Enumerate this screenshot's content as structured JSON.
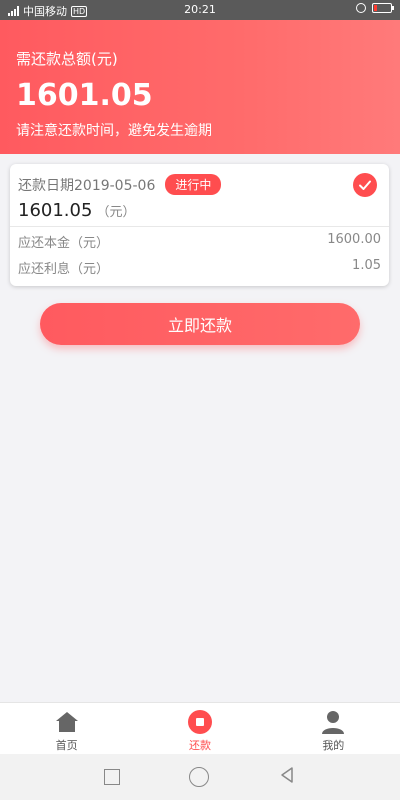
{
  "status_bar": {
    "carrier": "中国移动",
    "network": "HD",
    "time": "20:21"
  },
  "header": {
    "label": "需还款总额(元)",
    "amount": "1601.05",
    "tip": "请注意还款时间，避免发生逾期"
  },
  "card": {
    "date_label": "还款日期2019-05-06",
    "status": "进行中",
    "amount": "1601.05",
    "unit": "（元）",
    "principal_label": "应还本金（元）",
    "principal_value": "1600.00",
    "interest_label": "应还利息（元）",
    "interest_value": "1.05"
  },
  "repay_button": {
    "label": "立即还款"
  },
  "tabs": [
    {
      "label": "首页",
      "icon": "home-icon",
      "active": false
    },
    {
      "label": "还款",
      "icon": "repay-icon",
      "active": true
    },
    {
      "label": "我的",
      "icon": "profile-icon",
      "active": false
    }
  ],
  "colors": {
    "accent": "#ff4d4f",
    "header_bg": "#ff5a5f",
    "page_bg": "#f3f3f6"
  }
}
